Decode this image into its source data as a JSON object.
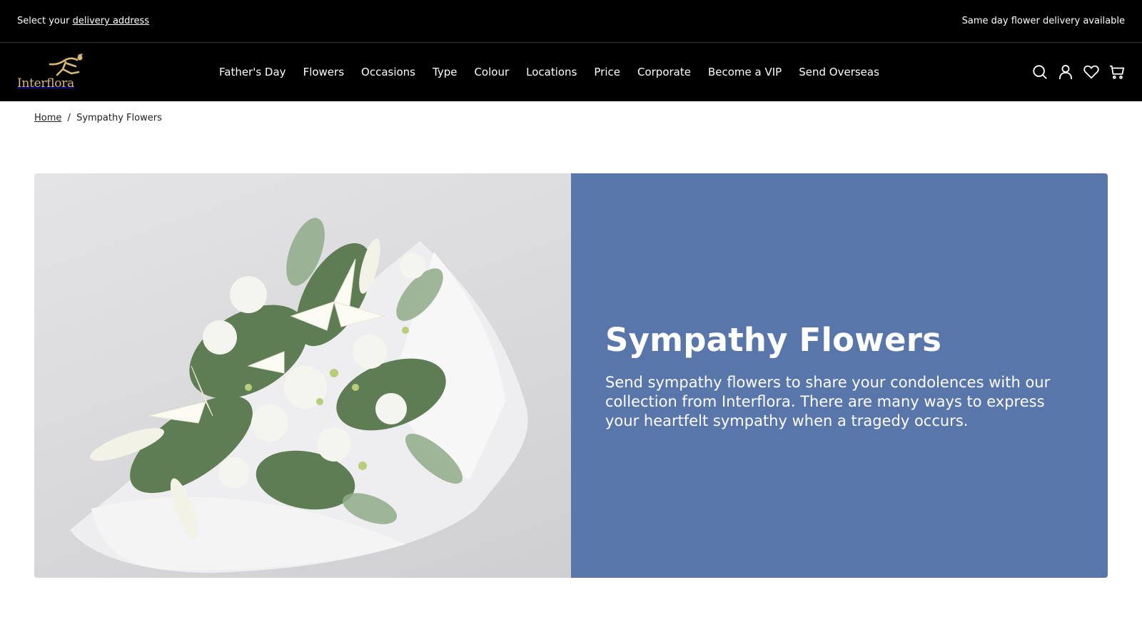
{
  "topbar": {
    "prefix": "Select your",
    "link": "delivery address",
    "right_text": "Same day flower delivery available"
  },
  "logo": {
    "text": "Interflora",
    "icon": "mercury-runner-icon"
  },
  "nav": {
    "items": [
      {
        "label": "Father's Day"
      },
      {
        "label": "Flowers"
      },
      {
        "label": "Occasions"
      },
      {
        "label": "Type"
      },
      {
        "label": "Colour"
      },
      {
        "label": "Locations"
      },
      {
        "label": "Price"
      },
      {
        "label": "Corporate"
      },
      {
        "label": "Become a VIP"
      },
      {
        "label": "Send Overseas"
      }
    ]
  },
  "header_icons": [
    "search-icon",
    "account-icon",
    "wishlist-heart-icon",
    "cart-icon"
  ],
  "breadcrumb": {
    "home": "Home",
    "separator": "/",
    "current": "Sympathy Flowers"
  },
  "hero": {
    "title": "Sympathy Flowers",
    "description": "Send sympathy flowers to share your condolences with our collection from Interflora. There are many ways to express your heartfelt sympathy when a tragedy occurs.",
    "panel_color": "#5876aa"
  },
  "colors": {
    "header_bg": "#000000",
    "logo_gold": "#d9b978"
  }
}
